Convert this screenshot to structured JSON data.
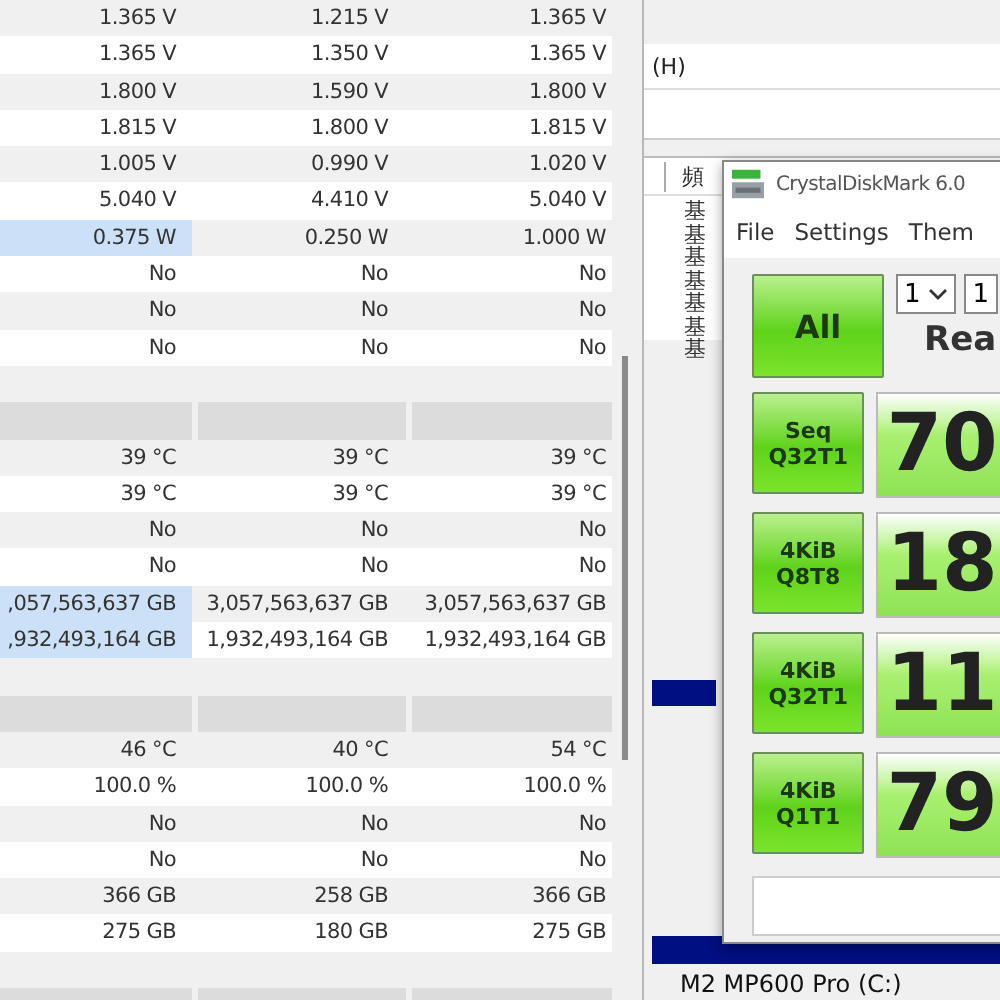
{
  "sensor_table": {
    "rows": [
      {
        "kind": "data",
        "cells": [
          {
            "text": "1.365 V",
            "highlighted": false
          },
          {
            "text": "1.215 V",
            "highlighted": false
          },
          {
            "text": "1.365 V",
            "highlighted": false
          }
        ]
      },
      {
        "kind": "data",
        "cells": [
          {
            "text": "1.365 V",
            "highlighted": false
          },
          {
            "text": "1.350 V",
            "highlighted": false
          },
          {
            "text": "1.365 V",
            "highlighted": false
          }
        ]
      },
      {
        "kind": "data",
        "cells": [
          {
            "text": "1.800 V",
            "highlighted": false
          },
          {
            "text": "1.590 V",
            "highlighted": false
          },
          {
            "text": "1.800 V",
            "highlighted": false
          }
        ]
      },
      {
        "kind": "data",
        "cells": [
          {
            "text": "1.815 V",
            "highlighted": false
          },
          {
            "text": "1.800 V",
            "highlighted": false
          },
          {
            "text": "1.815 V",
            "highlighted": false
          }
        ]
      },
      {
        "kind": "data",
        "cells": [
          {
            "text": "1.005 V",
            "highlighted": false
          },
          {
            "text": "0.990 V",
            "highlighted": false
          },
          {
            "text": "1.020 V",
            "highlighted": false
          }
        ]
      },
      {
        "kind": "data",
        "cells": [
          {
            "text": "5.040 V",
            "highlighted": false
          },
          {
            "text": "4.410 V",
            "highlighted": false
          },
          {
            "text": "5.040 V",
            "highlighted": false
          }
        ]
      },
      {
        "kind": "data",
        "cells": [
          {
            "text": "0.375 W",
            "highlighted": true
          },
          {
            "text": "0.250 W",
            "highlighted": false
          },
          {
            "text": "1.000 W",
            "highlighted": false
          }
        ]
      },
      {
        "kind": "data",
        "cells": [
          {
            "text": "No",
            "highlighted": false
          },
          {
            "text": "No",
            "highlighted": false
          },
          {
            "text": "No",
            "highlighted": false
          }
        ]
      },
      {
        "kind": "data",
        "cells": [
          {
            "text": "No",
            "highlighted": false
          },
          {
            "text": "No",
            "highlighted": false
          },
          {
            "text": "No",
            "highlighted": false
          }
        ]
      },
      {
        "kind": "data",
        "cells": [
          {
            "text": "No",
            "highlighted": false
          },
          {
            "text": "No",
            "highlighted": false
          },
          {
            "text": "No",
            "highlighted": false
          }
        ]
      },
      {
        "kind": "blank"
      },
      {
        "kind": "header"
      },
      {
        "kind": "data",
        "cells": [
          {
            "text": "39 °C",
            "highlighted": false
          },
          {
            "text": "39 °C",
            "highlighted": false
          },
          {
            "text": "39 °C",
            "highlighted": false
          }
        ]
      },
      {
        "kind": "data",
        "cells": [
          {
            "text": "39 °C",
            "highlighted": false
          },
          {
            "text": "39 °C",
            "highlighted": false
          },
          {
            "text": "39 °C",
            "highlighted": false
          }
        ]
      },
      {
        "kind": "data",
        "cells": [
          {
            "text": "No",
            "highlighted": false
          },
          {
            "text": "No",
            "highlighted": false
          },
          {
            "text": "No",
            "highlighted": false
          }
        ]
      },
      {
        "kind": "data",
        "cells": [
          {
            "text": "No",
            "highlighted": false
          },
          {
            "text": "No",
            "highlighted": false
          },
          {
            "text": "No",
            "highlighted": false
          }
        ]
      },
      {
        "kind": "data",
        "cells": [
          {
            "text": ",057,563,637 GB",
            "highlighted": true
          },
          {
            "text": "3,057,563,637 GB",
            "highlighted": false
          },
          {
            "text": "3,057,563,637 GB",
            "highlighted": false
          }
        ]
      },
      {
        "kind": "data",
        "cells": [
          {
            "text": ",932,493,164 GB",
            "highlighted": true
          },
          {
            "text": "1,932,493,164 GB",
            "highlighted": false
          },
          {
            "text": "1,932,493,164 GB",
            "highlighted": false
          }
        ]
      },
      {
        "kind": "blank"
      },
      {
        "kind": "header"
      },
      {
        "kind": "data",
        "cells": [
          {
            "text": "46 °C",
            "highlighted": false
          },
          {
            "text": "40 °C",
            "highlighted": false
          },
          {
            "text": "54 °C",
            "highlighted": false
          }
        ]
      },
      {
        "kind": "data",
        "cells": [
          {
            "text": "100.0 %",
            "highlighted": false
          },
          {
            "text": "100.0 %",
            "highlighted": false
          },
          {
            "text": "100.0 %",
            "highlighted": false
          }
        ]
      },
      {
        "kind": "data",
        "cells": [
          {
            "text": "No",
            "highlighted": false
          },
          {
            "text": "No",
            "highlighted": false
          },
          {
            "text": "No",
            "highlighted": false
          }
        ]
      },
      {
        "kind": "data",
        "cells": [
          {
            "text": "No",
            "highlighted": false
          },
          {
            "text": "No",
            "highlighted": false
          },
          {
            "text": "No",
            "highlighted": false
          }
        ]
      },
      {
        "kind": "data",
        "cells": [
          {
            "text": "366 GB",
            "highlighted": false
          },
          {
            "text": "258 GB",
            "highlighted": false
          },
          {
            "text": "366 GB",
            "highlighted": false
          }
        ]
      },
      {
        "kind": "data",
        "cells": [
          {
            "text": "275 GB",
            "highlighted": false
          },
          {
            "text": "180 GB",
            "highlighted": false
          },
          {
            "text": "275 GB",
            "highlighted": false
          }
        ]
      },
      {
        "kind": "blank"
      },
      {
        "kind": "header"
      }
    ]
  },
  "back_window": {
    "menu_item": "(H)",
    "list_header": "頻",
    "list_rows": [
      "基",
      "基",
      "基",
      "基",
      "基",
      "基",
      "基"
    ],
    "drive_label": "M2 MP600 Pro (C:)"
  },
  "crystaldiskmark": {
    "title": "CrystalDiskMark 6.0",
    "menu": [
      "File",
      "Settings",
      "Them"
    ],
    "all_button": "All",
    "selects": [
      "1",
      "1"
    ],
    "column_header": "Rea",
    "tests": [
      {
        "label": "Seq\nQ32T1",
        "value": "70"
      },
      {
        "label": "4KiB\nQ8T8",
        "value": "18"
      },
      {
        "label": "4KiB\nQ32T1",
        "value": "11"
      },
      {
        "label": "4KiB\nQ1T1",
        "value": "79"
      }
    ]
  }
}
